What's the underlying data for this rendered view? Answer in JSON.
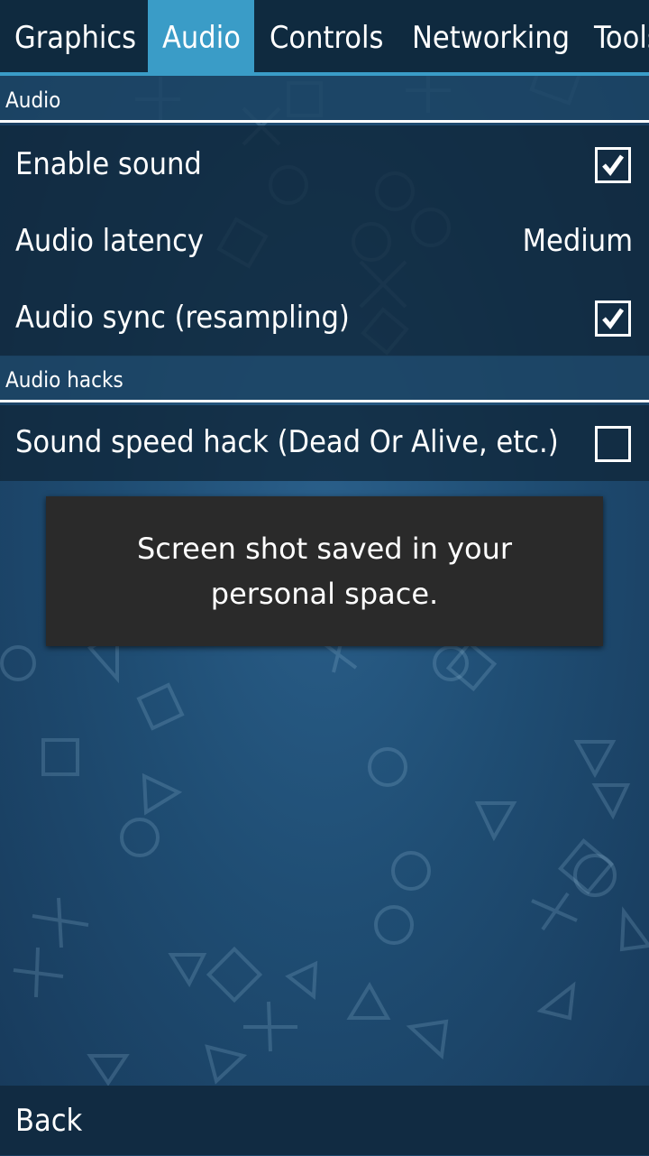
{
  "tabs": [
    {
      "label": "Graphics",
      "active": false
    },
    {
      "label": "Audio",
      "active": true
    },
    {
      "label": "Controls",
      "active": false
    },
    {
      "label": "Networking",
      "active": false
    },
    {
      "label": "Tools",
      "active": false
    }
  ],
  "sections": {
    "audio": {
      "header": "Audio",
      "items": [
        {
          "label": "Enable sound",
          "control": "checkbox",
          "checked": true
        },
        {
          "label": "Audio latency",
          "control": "value",
          "value": "Medium"
        },
        {
          "label": "Audio sync (resampling)",
          "control": "checkbox",
          "checked": true
        }
      ]
    },
    "audio_hacks": {
      "header": "Audio hacks",
      "items": [
        {
          "label": "Sound speed hack (Dead Or Alive, etc.)",
          "control": "checkbox",
          "checked": false
        }
      ]
    }
  },
  "toast": {
    "message": "Screen shot saved in your personal space."
  },
  "footer": {
    "back_label": "Back"
  },
  "colors": {
    "accent": "#3a9cc7",
    "tabbar": "#0f2a3f",
    "toast": "#2a2a2a"
  }
}
